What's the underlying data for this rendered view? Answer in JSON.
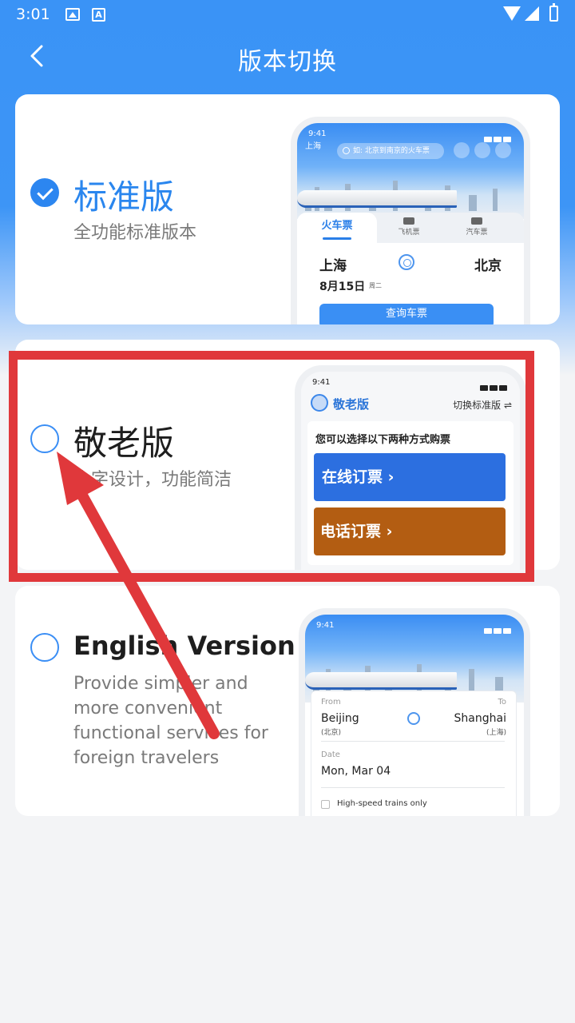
{
  "status_bar": {
    "time": "3:01"
  },
  "header": {
    "title": "版本切换"
  },
  "versions": [
    {
      "title": "标准版",
      "description": "全功能标准版本",
      "selected": true
    },
    {
      "title": "敬老版",
      "description": "大字设计，功能简洁",
      "selected": false
    },
    {
      "title": "English Version",
      "description": "Provide simpler and more convenient functional services for foreign travelers",
      "selected": false
    }
  ],
  "preview_standard": {
    "time": "9:41",
    "location": "上海",
    "search_placeholder": "如: 北京到南京的火车票",
    "tabs": [
      "火车票",
      "飞机票",
      "汽车票"
    ],
    "from": "上海",
    "to": "北京",
    "date": "8月15日",
    "weekday": "周二",
    "query_button": "查询车票"
  },
  "preview_elder": {
    "time": "9:41",
    "brand": "敬老版",
    "switch_label": "切换标准版 ⇌",
    "hint": "您可以选择以下两种方式购票",
    "online_button": "在线订票 ›",
    "phone_button": "电话订票 ›"
  },
  "preview_english": {
    "time": "9:41",
    "from_label": "From",
    "to_label": "To",
    "from_city": "Beijing",
    "from_city_cn": "(北京)",
    "to_city": "Shanghai",
    "to_city_cn": "(上海)",
    "date_label": "Date",
    "date_value": "Mon, Mar 04",
    "option_label": "High-speed trains only"
  },
  "colors": {
    "accent": "#2a86ee",
    "annotation": "#e0383b",
    "online_button": "#2c6fe0",
    "phone_button": "#b35d12"
  }
}
